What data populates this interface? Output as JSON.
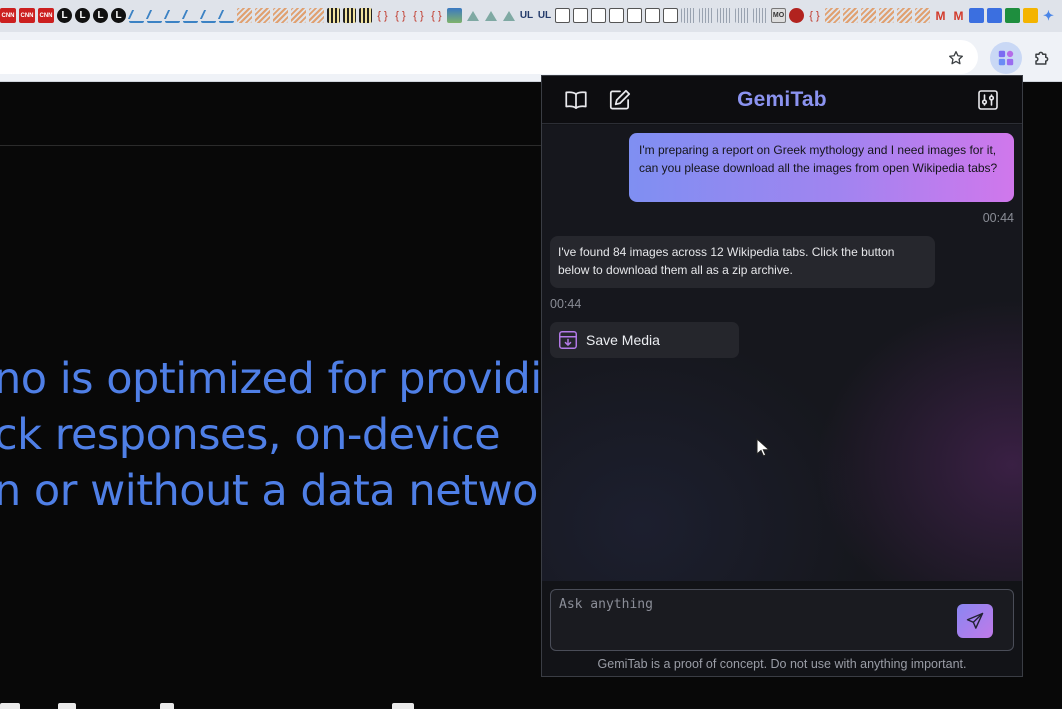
{
  "browser": {
    "tab_icons": [
      "cnn",
      "cnn",
      "cnn",
      "L",
      "L",
      "L",
      "L",
      "chart",
      "chart",
      "chart",
      "chart",
      "chart",
      "chart",
      "stripe",
      "stripe",
      "stripe",
      "stripe",
      "stripe",
      "bars",
      "bars",
      "bars",
      "brace",
      "brace",
      "brace",
      "brace",
      "img",
      "tri",
      "tri",
      "tri",
      "ul",
      "ul",
      "doc",
      "doc",
      "doc",
      "doc",
      "doc",
      "doc",
      "doc",
      "grey",
      "grey",
      "grey",
      "grey",
      "grey",
      "mo",
      "flower",
      "brace",
      "stripe",
      "stripe",
      "stripe",
      "stripe",
      "stripe",
      "stripe",
      "gmail",
      "gmail",
      "gdoc",
      "gdoc",
      "gsheet",
      "gslide",
      "star4"
    ],
    "tab_icon_texts": {
      "cnn": "CNN",
      "L": "L",
      "brace": "{ }",
      "ul": "UL",
      "mo": "MO",
      "gmail": "M",
      "star4": "✦"
    },
    "toolbar_icons": [
      "star-icon",
      "gemitab-extension-icon",
      "extensions-puzzle-icon"
    ]
  },
  "page": {
    "hero_lines": [
      "no is optimized for providin",
      "ck responses, on-device",
      "n or without a data networ"
    ]
  },
  "panel": {
    "title": "GemiTab",
    "header_icons": [
      "book-icon",
      "edit-icon",
      "settings-sliders-icon"
    ],
    "messages": {
      "user_text": "I'm preparing a report on Greek mythology and I need images for it, can you please download all the images from open Wikipedia tabs?",
      "user_time": "00:44",
      "assistant_text": "I've found 84 images across 12 Wikipedia tabs. Click the button below to download them all as a zip archive.",
      "assistant_time": "00:44"
    },
    "save_button_label": "Save Media",
    "input_placeholder": "Ask anything",
    "disclaimer": "GemiTab is a proof of concept. Do not use with anything important.",
    "colors": {
      "title": "#8b93f0",
      "user_bubble_start": "#7f8ff2",
      "user_bubble_end": "#d077ec",
      "accent": "#b47ae8"
    }
  }
}
